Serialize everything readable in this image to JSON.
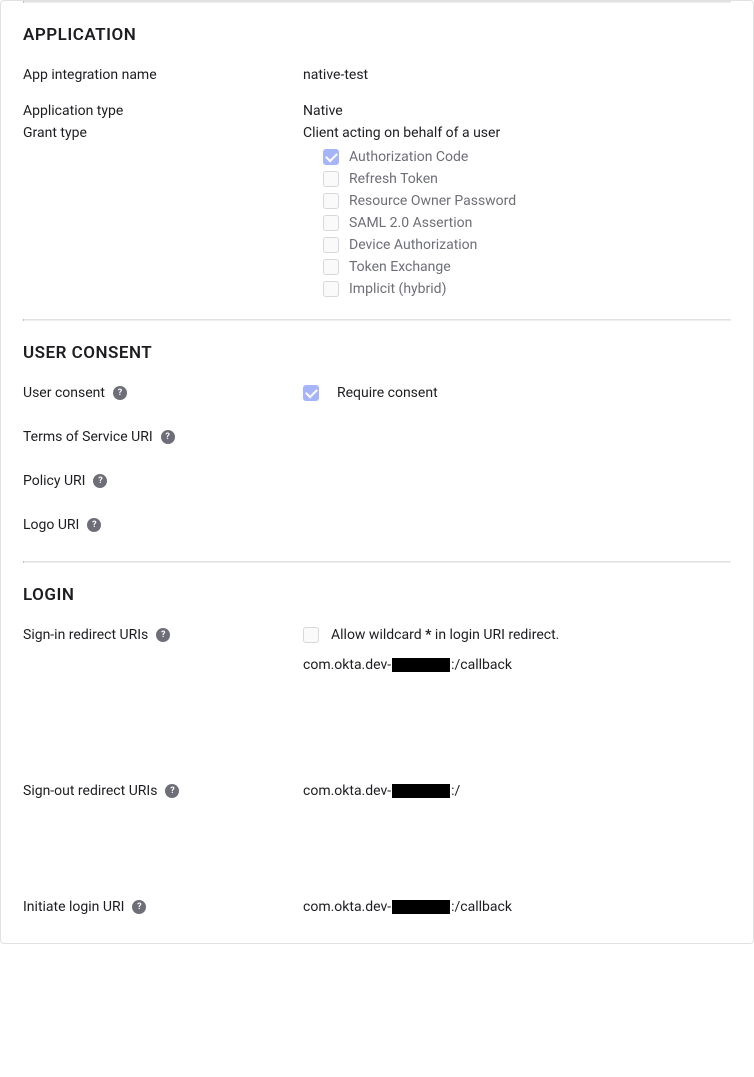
{
  "application": {
    "title": "APPLICATION",
    "name_label": "App integration name",
    "name_value": "native-test",
    "type_label": "Application type",
    "type_value": "Native",
    "grant_label": "Grant type",
    "grant_subheading": "Client acting on behalf of a user",
    "grant_options": [
      {
        "label": "Authorization Code",
        "checked": true
      },
      {
        "label": "Refresh Token",
        "checked": false
      },
      {
        "label": "Resource Owner Password",
        "checked": false
      },
      {
        "label": "SAML 2.0 Assertion",
        "checked": false
      },
      {
        "label": "Device Authorization",
        "checked": false
      },
      {
        "label": "Token Exchange",
        "checked": false
      },
      {
        "label": "Implicit (hybrid)",
        "checked": false
      }
    ]
  },
  "user_consent": {
    "title": "USER CONSENT",
    "consent_label": "User consent",
    "require_consent_label": "Require consent",
    "require_consent_checked": true,
    "tos_label": "Terms of Service URI",
    "policy_label": "Policy URI",
    "logo_label": "Logo URI"
  },
  "login": {
    "title": "LOGIN",
    "signin_label": "Sign-in redirect URIs",
    "wildcard_prefix": "Allow wildcard ",
    "wildcard_star": "*",
    "wildcard_suffix": " in login URI redirect.",
    "wildcard_checked": false,
    "signin_uri_prefix": "com.okta.dev-",
    "signin_uri_suffix": ":/callback",
    "signout_label": "Sign-out redirect URIs",
    "signout_uri_prefix": "com.okta.dev-",
    "signout_uri_suffix": ":/",
    "initiate_label": "Initiate login URI",
    "initiate_uri_prefix": "com.okta.dev-",
    "initiate_uri_suffix": ":/callback"
  }
}
